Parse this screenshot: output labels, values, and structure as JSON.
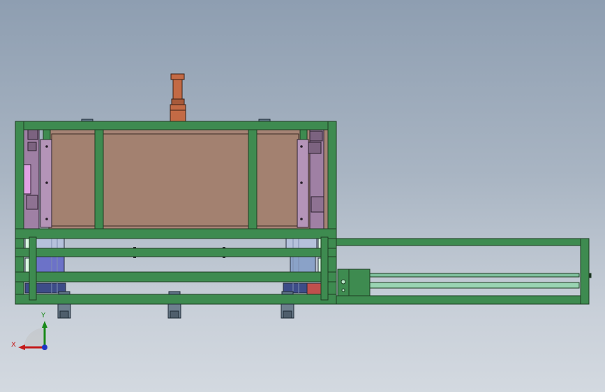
{
  "view": {
    "name": "cad-assembly-front-view",
    "triad": {
      "x_label": "X",
      "y_label": "Y"
    }
  },
  "colors": {
    "frame_green": "#3e8b50",
    "frame_edge": "#1d3d22",
    "panel_brown": "#a58375",
    "copper": "#c36a45",
    "rail_purple": "#b494b8",
    "rod_green": "#7fc09d",
    "foot_gray": "#6d7f8e",
    "accent_red": "#c0504d",
    "blue_block": "#6c72c8"
  }
}
